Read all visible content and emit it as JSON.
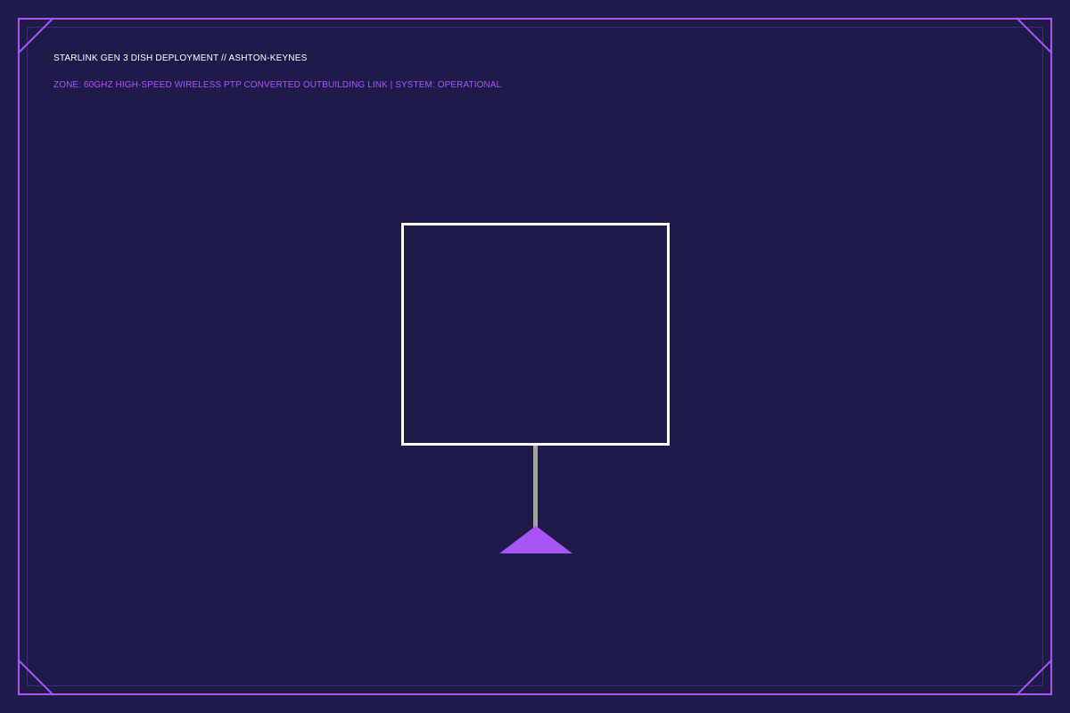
{
  "header": {
    "title": "STARLINK GEN 3 DISH DEPLOYMENT // ASHTON-KEYNES",
    "subtitle": "ZONE: 60GHZ HIGH-SPEED WIRELESS PTP CONVERTED OUTBUILDING LINK | SYSTEM: OPERATIONAL"
  },
  "colors": {
    "background": "#1e1b4b",
    "accent": "#a855f7",
    "dish_outline": "#ffffff",
    "mast": "#a3a3a3"
  },
  "icons": {
    "corners": "corner-bracket-icon",
    "base": "triangle-base-icon"
  }
}
